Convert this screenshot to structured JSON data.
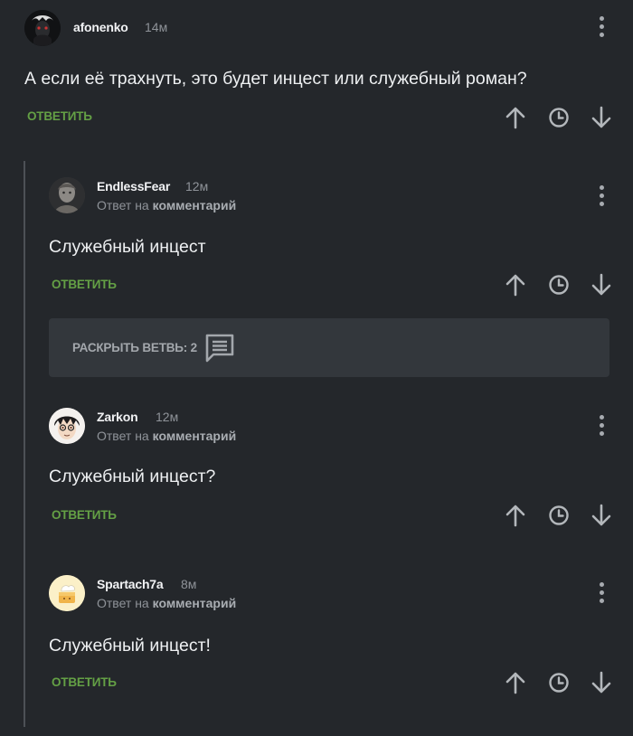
{
  "comments": [
    {
      "username": "afonenko",
      "time": "14м",
      "text": "А если её трахнуть, это будет инцест или служебный роман?",
      "reply_label": "ОТВЕТИТЬ"
    },
    {
      "username": "EndlessFear",
      "time": "12м",
      "reply_prefix": "Ответ на",
      "reply_target": "комментарий",
      "text": "Служебный инцест",
      "reply_label": "ОТВЕТИТЬ"
    },
    {
      "username": "Zarkon",
      "time": "12м",
      "reply_prefix": "Ответ на",
      "reply_target": "комментарий",
      "text": "Служебный инцест?",
      "reply_label": "ОТВЕТИТЬ"
    },
    {
      "username": "Spartach7a",
      "time": "8м",
      "reply_prefix": "Ответ на",
      "reply_target": "комментарий",
      "text": "Служебный инцест!",
      "reply_label": "ОТВЕТИТЬ"
    }
  ],
  "expand_thread": {
    "label": "РАСКРЫТЬ ВЕТВЬ: 2",
    "icon": "comment-icon"
  },
  "icons": [
    "more-vertical-icon",
    "arrow-up-icon",
    "clock-icon",
    "arrow-down-icon"
  ],
  "colors": {
    "background": "#24272b",
    "accent_green": "#64a045",
    "expand_bg": "#33373c"
  }
}
